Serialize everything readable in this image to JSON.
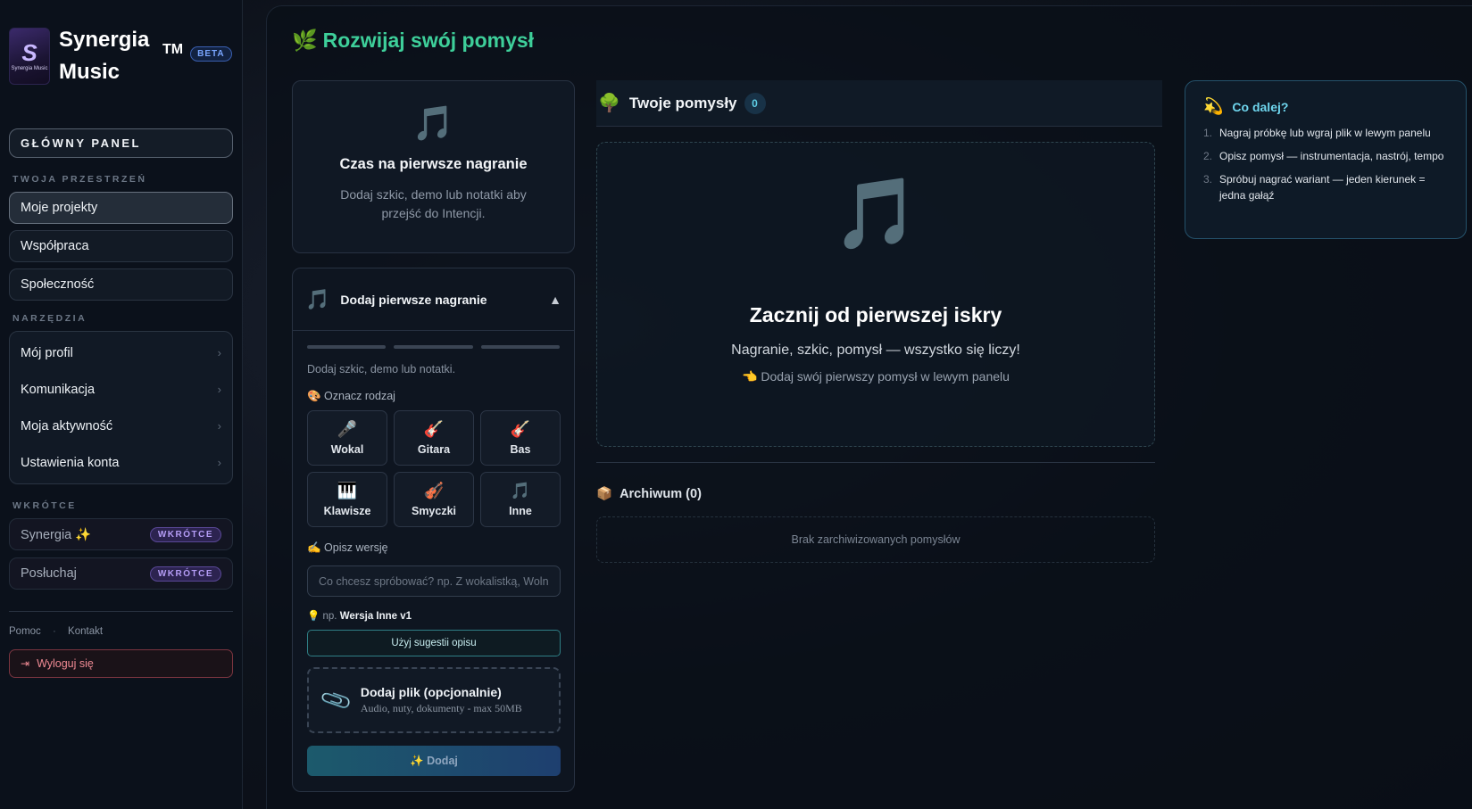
{
  "brand": {
    "logo_letter": "S",
    "logo_text": "Synergia Music",
    "name": "Synergia Music",
    "tm": "TM",
    "beta": "BETA"
  },
  "sidebar": {
    "main_panel": "GŁÓWNY PANEL",
    "workspace_label": "TWOJA PRZESTRZEŃ",
    "workspace_items": [
      {
        "label": "Moje projekty",
        "active": true
      },
      {
        "label": "Współpraca",
        "active": false
      },
      {
        "label": "Społeczność",
        "active": false
      }
    ],
    "tools_label": "NARZĘDZIA",
    "tools_items": [
      {
        "label": "Mój profil"
      },
      {
        "label": "Komunikacja"
      },
      {
        "label": "Moja aktywność"
      },
      {
        "label": "Ustawienia konta"
      }
    ],
    "soon_label": "WKRÓTCE",
    "soon_items": [
      {
        "label": "Synergia ✨",
        "badge": "WKRÓTCE"
      },
      {
        "label": "Posłuchaj",
        "badge": "WKRÓTCE"
      }
    ],
    "footer": {
      "help": "Pomoc",
      "sep": "·",
      "contact": "Kontakt"
    },
    "logout": "Wyloguj się"
  },
  "main": {
    "page_title_icon": "🌿",
    "page_title": "Rozwijaj swój pomysł",
    "start_card": {
      "icon": "🎵",
      "title": "Czas na pierwsze nagranie",
      "text": "Dodaj szkic, demo lub notatki aby przejść do Intencji."
    },
    "add_card": {
      "icon": "🎵",
      "title": "Dodaj pierwsze nagranie",
      "caret": "▲",
      "hint": "Dodaj szkic, demo lub notatki.",
      "type_label": "🎨 Oznacz rodzaj",
      "types": [
        {
          "icon": "🎤",
          "label": "Wokal"
        },
        {
          "icon": "🎸",
          "label": "Gitara"
        },
        {
          "icon": "🎸",
          "label": "Bas"
        },
        {
          "icon": "🎹",
          "label": "Klawisze"
        },
        {
          "icon": "🎻",
          "label": "Smyczki"
        },
        {
          "icon": "🎵",
          "label": "Inne"
        }
      ],
      "describe_label": "✍️ Opisz wersję",
      "describe_placeholder": "Co chcesz spróbować? np. Z wokalistką, Wolniej",
      "suggest_prefix": "💡 np.",
      "suggest_value": "Wersja Inne v1",
      "use_suggestion": "Użyj sugestii opisu",
      "file_title": "Dodaj plik (opcjonalnie)",
      "file_sub": "Audio, nuty, dokumenty - max 50MB",
      "submit": "✨ Dodaj"
    },
    "ideas": {
      "icon": "🌳",
      "title": "Twoje pomysły",
      "count": "0",
      "empty_icon": "🎵",
      "empty_title": "Zacznij od pierwszej iskry",
      "empty_sub": "Nagranie, szkic, pomysł — wszystko się liczy!",
      "empty_hint": "👈 Dodaj swój pierwszy pomysł w lewym panelu"
    },
    "archive": {
      "icon": "📦",
      "title": "Archiwum (0)",
      "empty": "Brak zarchiwizowanych pomysłów"
    },
    "next": {
      "icon": "💫",
      "title": "Co dalej?",
      "items": [
        {
          "n": "1.",
          "text": "Nagraj próbkę lub wgraj plik w lewym panelu"
        },
        {
          "n": "2.",
          "text": "Opisz pomysł — instrumentacja, nastrój, tempo"
        },
        {
          "n": "3.",
          "text": "Spróbuj nagrać wariant — jeden kierunek = jedna gałąź"
        }
      ]
    }
  }
}
